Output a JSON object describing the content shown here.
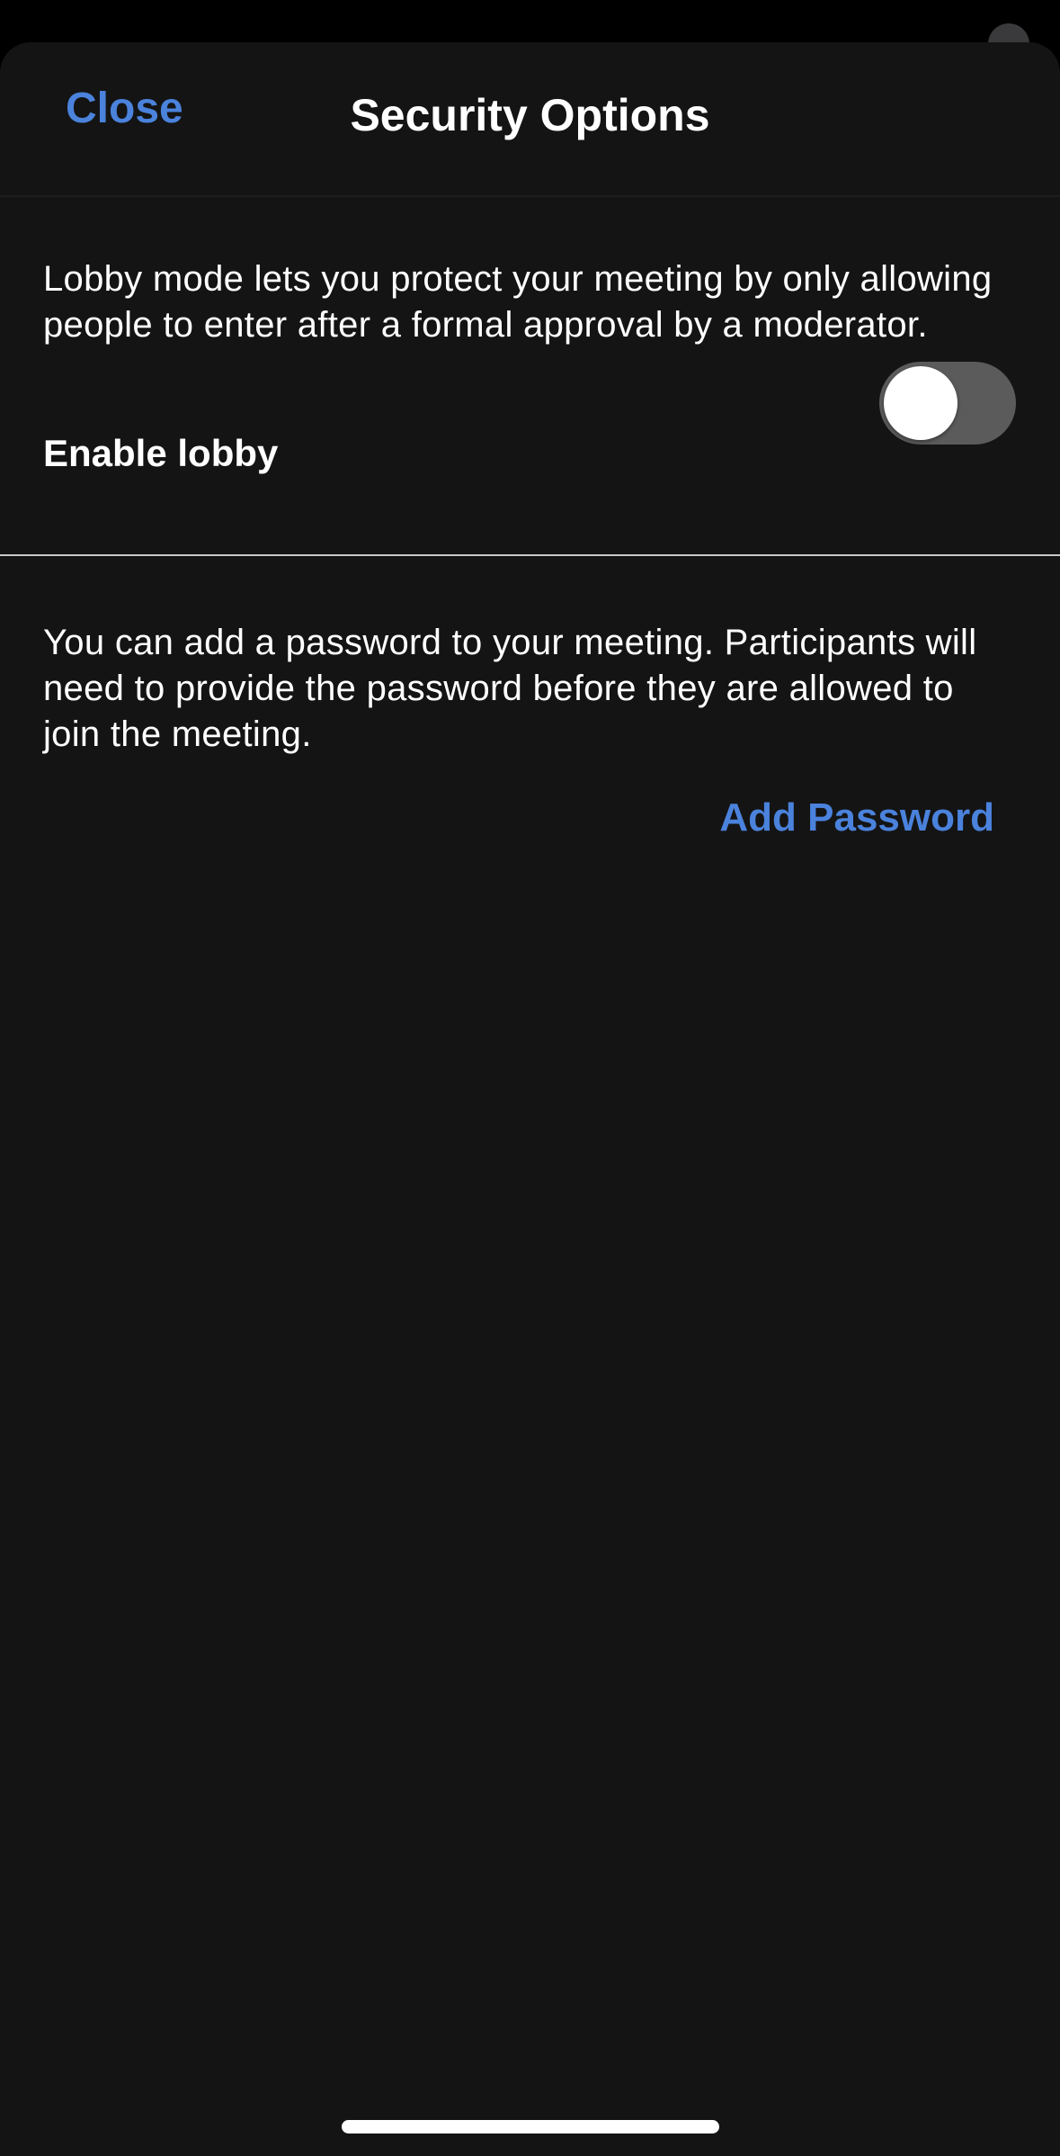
{
  "header": {
    "close_label": "Close",
    "title": "Security Options"
  },
  "lobby": {
    "description": "Lobby mode lets you protect your meeting by only allowing people to enter after a formal approval by a moderator.",
    "toggle_label": "Enable lobby",
    "enabled": false
  },
  "password": {
    "description": "You can add a password to your meeting. Participants will need to provide the password before they are allowed to join the meeting.",
    "add_label": "Add Password"
  },
  "colors": {
    "accent": "#4a82dc",
    "background": "#141414",
    "toggle_off": "#5b5b5b"
  }
}
